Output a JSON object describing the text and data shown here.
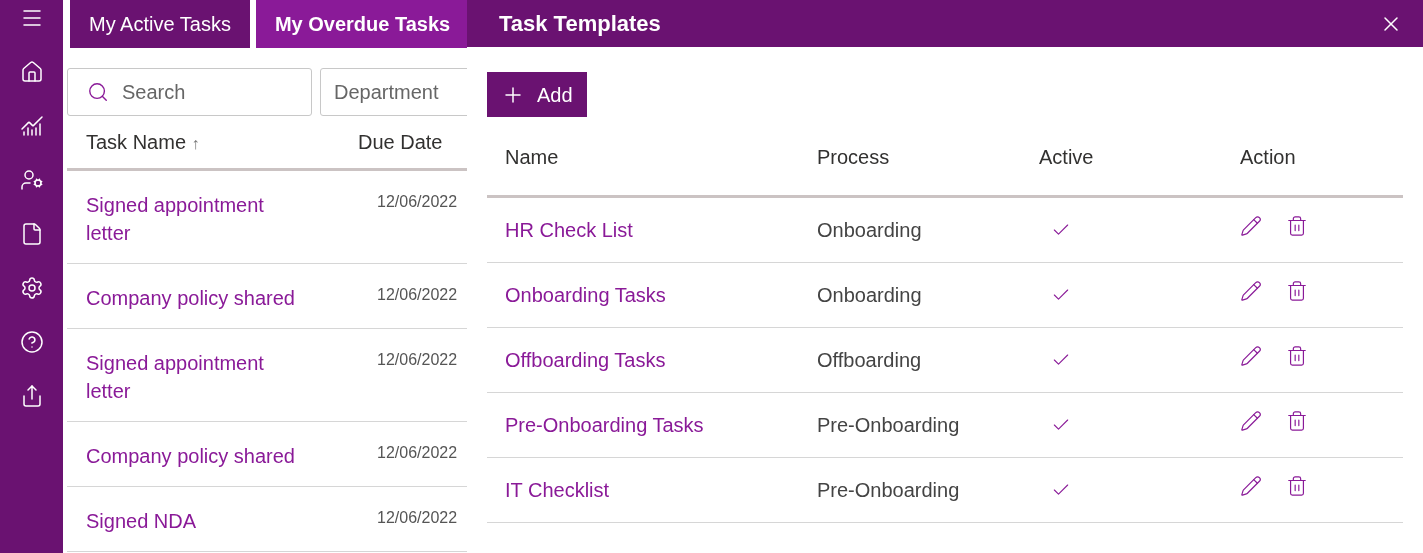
{
  "sidebar": {
    "items": [
      {
        "kind": "menu"
      },
      {
        "kind": "home"
      },
      {
        "kind": "chart"
      },
      {
        "kind": "user-settings"
      },
      {
        "kind": "document"
      },
      {
        "kind": "settings"
      },
      {
        "kind": "help"
      },
      {
        "kind": "share"
      }
    ]
  },
  "tabs": [
    {
      "label": "My Active Tasks",
      "selected": false
    },
    {
      "label": "My Overdue Tasks",
      "selected": true
    }
  ],
  "search": {
    "placeholder": "Search"
  },
  "department": {
    "placeholder": "Department"
  },
  "task_table": {
    "columns": [
      {
        "label": "Task Name",
        "sort": "↑"
      },
      {
        "label": "Due Date"
      }
    ],
    "rows": [
      {
        "name": "Signed appointment letter",
        "due": "12/06/2022"
      },
      {
        "name": "Company policy shared",
        "due": "12/06/2022"
      },
      {
        "name": "Signed appointment letter",
        "due": "12/06/2022"
      },
      {
        "name": "Company policy shared",
        "due": "12/06/2022"
      },
      {
        "name": "Signed NDA",
        "due": "12/06/2022"
      }
    ]
  },
  "panel": {
    "title": "Task Templates",
    "add_button": "Add",
    "columns": [
      "Name",
      "Process",
      "Active",
      "Action"
    ],
    "rows": [
      {
        "name": "HR Check List",
        "process": "Onboarding",
        "active": true
      },
      {
        "name": "Onboarding Tasks",
        "process": "Onboarding",
        "active": true
      },
      {
        "name": "Offboarding Tasks",
        "process": "Offboarding",
        "active": true
      },
      {
        "name": "Pre-Onboarding Tasks",
        "process": "Pre-Onboarding",
        "active": true
      },
      {
        "name": "IT Checklist",
        "process": "Pre-Onboarding",
        "active": true
      }
    ]
  }
}
